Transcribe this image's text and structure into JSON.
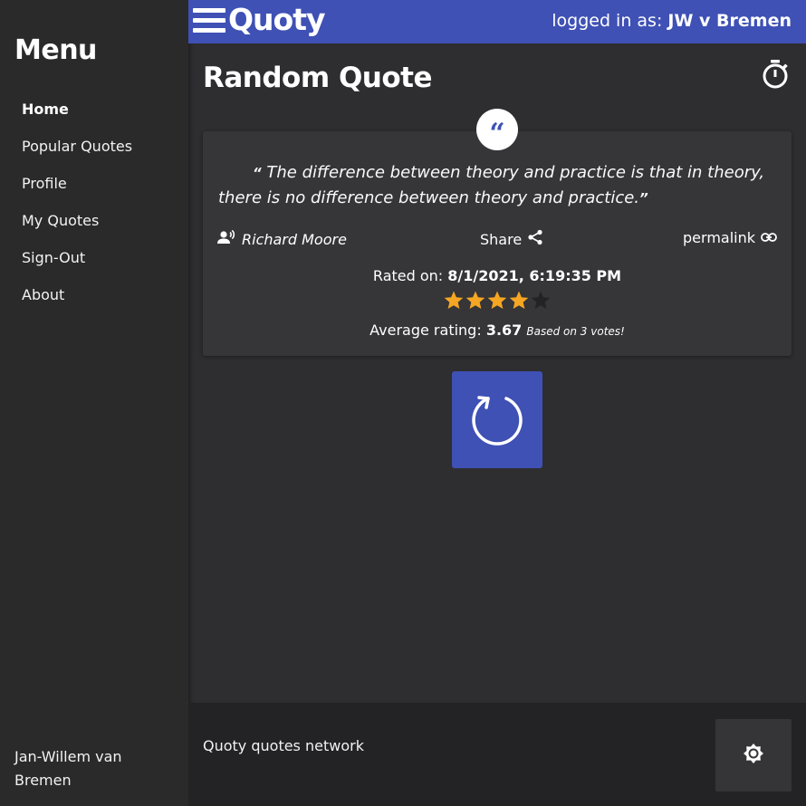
{
  "app": {
    "brand": "Quoty",
    "login_prefix": "logged in as: ",
    "login_user": "JW v Bremen"
  },
  "sidebar": {
    "title": "Menu",
    "items": [
      {
        "label": "Home",
        "active": true
      },
      {
        "label": "Popular Quotes",
        "active": false
      },
      {
        "label": "Profile",
        "active": false
      },
      {
        "label": "My Quotes",
        "active": false
      },
      {
        "label": "Sign-Out",
        "active": false
      },
      {
        "label": "About",
        "active": false
      }
    ],
    "footer_name": "Jan-Willem van Bremen"
  },
  "main": {
    "title": "Random Quote",
    "quote": {
      "open_mark": "“",
      "text": "The difference between theory and practice is that in theory, there is no difference between theory and practice.",
      "close_mark": "”",
      "author": "Richard Moore",
      "share_label": "Share",
      "permalink_label": "permalink",
      "rated_prefix": "Rated on: ",
      "rated_date": "8/1/2021, 6:19:35 PM",
      "user_rating": 4,
      "max_rating": 5,
      "avg_prefix": "Average rating: ",
      "avg_value": "3.67",
      "votes_text": "Based on 3 votes!"
    }
  },
  "footer": {
    "text": "Quoty quotes network"
  },
  "icons": {
    "menu": "hamburger-icon",
    "timer": "timer-icon",
    "quote": "quote-icon",
    "author": "speaker-icon",
    "share": "share-icon",
    "permalink": "link-icon",
    "refresh": "refresh-icon",
    "theme": "brightness-icon"
  },
  "colors": {
    "accent": "#3f51b5",
    "star_filled": "#f5a623",
    "star_empty": "#232224",
    "background": "#2e2d30",
    "sidebar": "#2a2a2b",
    "card": "#363537"
  }
}
